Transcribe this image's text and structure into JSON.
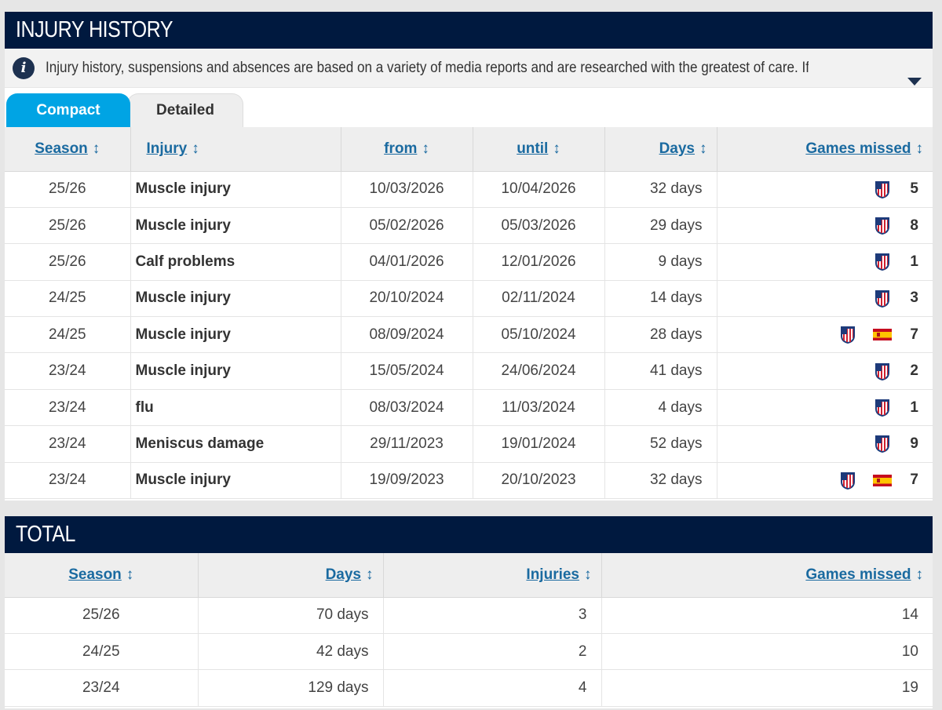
{
  "history": {
    "title": "INJURY HISTORY",
    "info_text": "Injury history, suspensions and absences are based on a variety of media reports and are researched with the greatest of care. If you should n...",
    "tabs": {
      "compact": "Compact",
      "detailed": "Detailed"
    },
    "headers": {
      "season": "Season",
      "injury": "Injury",
      "from": "from",
      "until": "until",
      "days": "Days",
      "games": "Games missed"
    },
    "sort_arrow": "↕",
    "rows": [
      {
        "season": "25/26",
        "injury": "Muscle injury",
        "from": "10/03/2026",
        "until": "10/04/2026",
        "days": "32 days",
        "games": "5",
        "crest_icons": [
          "atletico-crest-icon"
        ]
      },
      {
        "season": "25/26",
        "injury": "Muscle injury",
        "from": "05/02/2026",
        "until": "05/03/2026",
        "days": "29 days",
        "games": "8",
        "crest_icons": [
          "atletico-crest-icon"
        ]
      },
      {
        "season": "25/26",
        "injury": "Calf problems",
        "from": "04/01/2026",
        "until": "12/01/2026",
        "days": "9 days",
        "games": "1",
        "crest_icons": [
          "atletico-crest-icon"
        ]
      },
      {
        "season": "24/25",
        "injury": "Muscle injury",
        "from": "20/10/2024",
        "until": "02/11/2024",
        "days": "14 days",
        "games": "3",
        "crest_icons": [
          "atletico-crest-icon"
        ]
      },
      {
        "season": "24/25",
        "injury": "Muscle injury",
        "from": "08/09/2024",
        "until": "05/10/2024",
        "days": "28 days",
        "games": "7",
        "crest_icons": [
          "atletico-crest-icon",
          "spain-flag-icon"
        ]
      },
      {
        "season": "23/24",
        "injury": "Muscle injury",
        "from": "15/05/2024",
        "until": "24/06/2024",
        "days": "41 days",
        "games": "2",
        "crest_icons": [
          "atletico-crest-icon"
        ]
      },
      {
        "season": "23/24",
        "injury": "flu",
        "from": "08/03/2024",
        "until": "11/03/2024",
        "days": "4 days",
        "games": "1",
        "crest_icons": [
          "atletico-crest-icon"
        ]
      },
      {
        "season": "23/24",
        "injury": "Meniscus damage",
        "from": "29/11/2023",
        "until": "19/01/2024",
        "days": "52 days",
        "games": "9",
        "crest_icons": [
          "atletico-crest-icon"
        ]
      },
      {
        "season": "23/24",
        "injury": "Muscle injury",
        "from": "19/09/2023",
        "until": "20/10/2023",
        "days": "32 days",
        "games": "7",
        "crest_icons": [
          "atletico-crest-icon",
          "spain-flag-icon"
        ]
      }
    ]
  },
  "total": {
    "title": "TOTAL",
    "headers": {
      "season": "Season",
      "days": "Days",
      "injuries": "Injuries",
      "games": "Games missed"
    },
    "rows": [
      {
        "season": "25/26",
        "days": "70 days",
        "injuries": "3",
        "games": "14"
      },
      {
        "season": "24/25",
        "days": "42 days",
        "injuries": "2",
        "games": "10"
      },
      {
        "season": "23/24",
        "days": "129 days",
        "injuries": "4",
        "games": "19"
      }
    ]
  },
  "colors": {
    "header_bg": "#00193f",
    "tab_active": "#00a4e4",
    "link": "#1a6aa0",
    "flag_red": "#c60b1e",
    "flag_yellow": "#ffc400"
  }
}
